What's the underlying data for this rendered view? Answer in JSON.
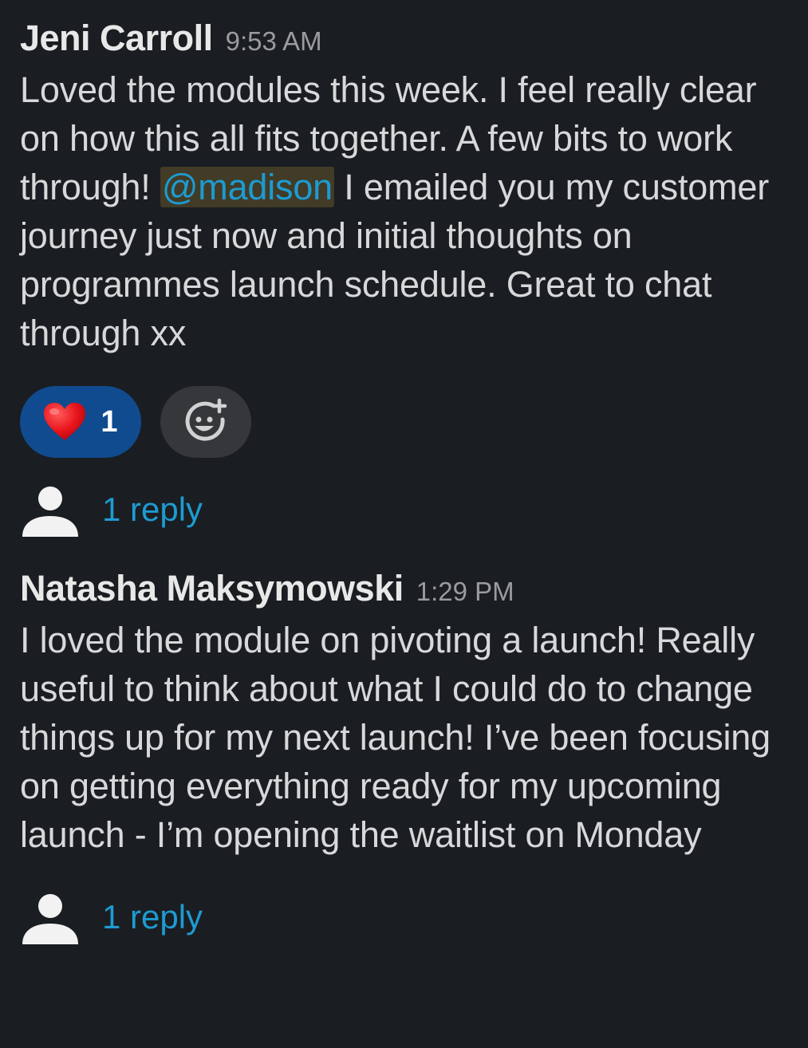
{
  "messages": [
    {
      "author": "Jeni Carroll",
      "time": "9:53 AM",
      "text_before_mention": "Loved the modules this week. I feel really clear on how this all fits together. A few bits to work through! ",
      "mention": "@madison",
      "text_after_mention": " I emailed you my customer journey just now and initial thoughts on programmes launch schedule. Great to chat through xx",
      "reactions": [
        {
          "emoji": "heart-emoji",
          "count": "1"
        }
      ],
      "replies_label": "1 reply"
    },
    {
      "author": "Natasha Maksymowski",
      "time": "1:29 PM",
      "text": "I loved the module on pivoting a launch! Really useful to think about what I could do to change things up for my next launch! I’ve been focusing on getting everything ready for my upcoming launch - I’m opening the waitlist on Monday",
      "replies_label": "1 reply"
    }
  ],
  "colors": {
    "background": "#1a1d21",
    "link": "#1d9bd1",
    "reaction_selected": "#104b8f",
    "add_reaction_bg": "#35373b"
  },
  "icons": {
    "reaction": "heart-emoji",
    "add_reaction": "add-reaction-icon",
    "reply_avatar": "user-avatar-icon"
  }
}
